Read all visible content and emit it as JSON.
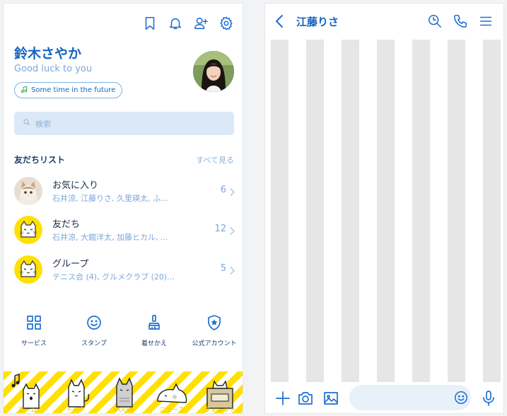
{
  "profile": {
    "name": "鈴木さやか",
    "status": "Good luck to you",
    "music": "Some time in the future",
    "header_icons": [
      "bookmark-icon",
      "bell-icon",
      "add-friend-icon",
      "gear-icon"
    ]
  },
  "search": {
    "placeholder": "検索"
  },
  "friends": {
    "title": "友だちリスト",
    "see_all": "すべて見る",
    "rows": [
      {
        "name": "お気に入り",
        "members": "石井涼, 江藤りさ, 久里瑛太, ふ...",
        "count": "6"
      },
      {
        "name": "友だち",
        "members": "石井涼, 大舘洋太, 加藤ヒカル, ...",
        "count": "12"
      },
      {
        "name": "グループ",
        "members": "テニス会 (4), グルメクラブ (20)...",
        "count": "5"
      }
    ]
  },
  "bottom_nav": [
    {
      "label": "サービス",
      "icon": "grid-icon"
    },
    {
      "label": "スタンプ",
      "icon": "smiley-icon"
    },
    {
      "label": "着せかえ",
      "icon": "brush-icon"
    },
    {
      "label": "公式アカウント",
      "icon": "official-badge-icon"
    }
  ],
  "tabs": [
    {
      "label": "ホーム"
    },
    {
      "label": "トーク"
    },
    {
      "label": "VOOM"
    },
    {
      "label": "ニュース"
    },
    {
      "label": "ウォレット"
    }
  ],
  "chat": {
    "title": "江藤りさ",
    "header_icons": [
      "search-icon",
      "phone-icon",
      "menu-icon"
    ],
    "input_value": ""
  },
  "colors": {
    "accent": "#1565c0",
    "icon_blue": "#1f6fd0",
    "tab_yellow": "#ffe000",
    "stripe_gray": "#e6e6e6",
    "search_bg": "#dbe9f7"
  }
}
